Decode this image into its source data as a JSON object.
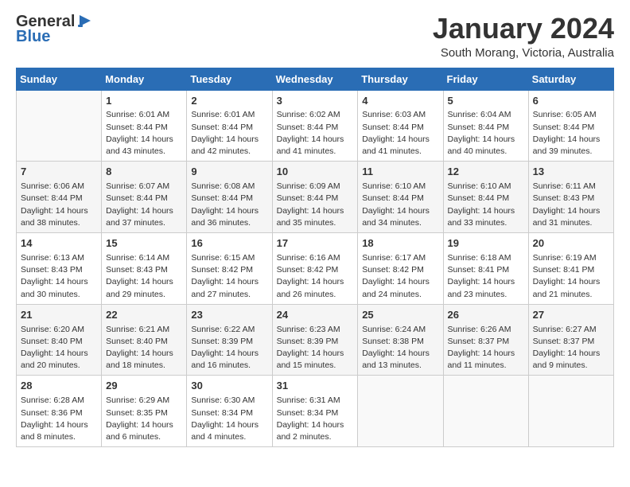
{
  "header": {
    "logo_line1": "General",
    "logo_line2": "Blue",
    "month": "January 2024",
    "location": "South Morang, Victoria, Australia"
  },
  "weekdays": [
    "Sunday",
    "Monday",
    "Tuesday",
    "Wednesday",
    "Thursday",
    "Friday",
    "Saturday"
  ],
  "weeks": [
    [
      {
        "day": "",
        "sunrise": "",
        "sunset": "",
        "daylight": ""
      },
      {
        "day": "1",
        "sunrise": "Sunrise: 6:01 AM",
        "sunset": "Sunset: 8:44 PM",
        "daylight": "Daylight: 14 hours and 43 minutes."
      },
      {
        "day": "2",
        "sunrise": "Sunrise: 6:01 AM",
        "sunset": "Sunset: 8:44 PM",
        "daylight": "Daylight: 14 hours and 42 minutes."
      },
      {
        "day": "3",
        "sunrise": "Sunrise: 6:02 AM",
        "sunset": "Sunset: 8:44 PM",
        "daylight": "Daylight: 14 hours and 41 minutes."
      },
      {
        "day": "4",
        "sunrise": "Sunrise: 6:03 AM",
        "sunset": "Sunset: 8:44 PM",
        "daylight": "Daylight: 14 hours and 41 minutes."
      },
      {
        "day": "5",
        "sunrise": "Sunrise: 6:04 AM",
        "sunset": "Sunset: 8:44 PM",
        "daylight": "Daylight: 14 hours and 40 minutes."
      },
      {
        "day": "6",
        "sunrise": "Sunrise: 6:05 AM",
        "sunset": "Sunset: 8:44 PM",
        "daylight": "Daylight: 14 hours and 39 minutes."
      }
    ],
    [
      {
        "day": "7",
        "sunrise": "Sunrise: 6:06 AM",
        "sunset": "Sunset: 8:44 PM",
        "daylight": "Daylight: 14 hours and 38 minutes."
      },
      {
        "day": "8",
        "sunrise": "Sunrise: 6:07 AM",
        "sunset": "Sunset: 8:44 PM",
        "daylight": "Daylight: 14 hours and 37 minutes."
      },
      {
        "day": "9",
        "sunrise": "Sunrise: 6:08 AM",
        "sunset": "Sunset: 8:44 PM",
        "daylight": "Daylight: 14 hours and 36 minutes."
      },
      {
        "day": "10",
        "sunrise": "Sunrise: 6:09 AM",
        "sunset": "Sunset: 8:44 PM",
        "daylight": "Daylight: 14 hours and 35 minutes."
      },
      {
        "day": "11",
        "sunrise": "Sunrise: 6:10 AM",
        "sunset": "Sunset: 8:44 PM",
        "daylight": "Daylight: 14 hours and 34 minutes."
      },
      {
        "day": "12",
        "sunrise": "Sunrise: 6:10 AM",
        "sunset": "Sunset: 8:44 PM",
        "daylight": "Daylight: 14 hours and 33 minutes."
      },
      {
        "day": "13",
        "sunrise": "Sunrise: 6:11 AM",
        "sunset": "Sunset: 8:43 PM",
        "daylight": "Daylight: 14 hours and 31 minutes."
      }
    ],
    [
      {
        "day": "14",
        "sunrise": "Sunrise: 6:13 AM",
        "sunset": "Sunset: 8:43 PM",
        "daylight": "Daylight: 14 hours and 30 minutes."
      },
      {
        "day": "15",
        "sunrise": "Sunrise: 6:14 AM",
        "sunset": "Sunset: 8:43 PM",
        "daylight": "Daylight: 14 hours and 29 minutes."
      },
      {
        "day": "16",
        "sunrise": "Sunrise: 6:15 AM",
        "sunset": "Sunset: 8:42 PM",
        "daylight": "Daylight: 14 hours and 27 minutes."
      },
      {
        "day": "17",
        "sunrise": "Sunrise: 6:16 AM",
        "sunset": "Sunset: 8:42 PM",
        "daylight": "Daylight: 14 hours and 26 minutes."
      },
      {
        "day": "18",
        "sunrise": "Sunrise: 6:17 AM",
        "sunset": "Sunset: 8:42 PM",
        "daylight": "Daylight: 14 hours and 24 minutes."
      },
      {
        "day": "19",
        "sunrise": "Sunrise: 6:18 AM",
        "sunset": "Sunset: 8:41 PM",
        "daylight": "Daylight: 14 hours and 23 minutes."
      },
      {
        "day": "20",
        "sunrise": "Sunrise: 6:19 AM",
        "sunset": "Sunset: 8:41 PM",
        "daylight": "Daylight: 14 hours and 21 minutes."
      }
    ],
    [
      {
        "day": "21",
        "sunrise": "Sunrise: 6:20 AM",
        "sunset": "Sunset: 8:40 PM",
        "daylight": "Daylight: 14 hours and 20 minutes."
      },
      {
        "day": "22",
        "sunrise": "Sunrise: 6:21 AM",
        "sunset": "Sunset: 8:40 PM",
        "daylight": "Daylight: 14 hours and 18 minutes."
      },
      {
        "day": "23",
        "sunrise": "Sunrise: 6:22 AM",
        "sunset": "Sunset: 8:39 PM",
        "daylight": "Daylight: 14 hours and 16 minutes."
      },
      {
        "day": "24",
        "sunrise": "Sunrise: 6:23 AM",
        "sunset": "Sunset: 8:39 PM",
        "daylight": "Daylight: 14 hours and 15 minutes."
      },
      {
        "day": "25",
        "sunrise": "Sunrise: 6:24 AM",
        "sunset": "Sunset: 8:38 PM",
        "daylight": "Daylight: 14 hours and 13 minutes."
      },
      {
        "day": "26",
        "sunrise": "Sunrise: 6:26 AM",
        "sunset": "Sunset: 8:37 PM",
        "daylight": "Daylight: 14 hours and 11 minutes."
      },
      {
        "day": "27",
        "sunrise": "Sunrise: 6:27 AM",
        "sunset": "Sunset: 8:37 PM",
        "daylight": "Daylight: 14 hours and 9 minutes."
      }
    ],
    [
      {
        "day": "28",
        "sunrise": "Sunrise: 6:28 AM",
        "sunset": "Sunset: 8:36 PM",
        "daylight": "Daylight: 14 hours and 8 minutes."
      },
      {
        "day": "29",
        "sunrise": "Sunrise: 6:29 AM",
        "sunset": "Sunset: 8:35 PM",
        "daylight": "Daylight: 14 hours and 6 minutes."
      },
      {
        "day": "30",
        "sunrise": "Sunrise: 6:30 AM",
        "sunset": "Sunset: 8:34 PM",
        "daylight": "Daylight: 14 hours and 4 minutes."
      },
      {
        "day": "31",
        "sunrise": "Sunrise: 6:31 AM",
        "sunset": "Sunset: 8:34 PM",
        "daylight": "Daylight: 14 hours and 2 minutes."
      },
      {
        "day": "",
        "sunrise": "",
        "sunset": "",
        "daylight": ""
      },
      {
        "day": "",
        "sunrise": "",
        "sunset": "",
        "daylight": ""
      },
      {
        "day": "",
        "sunrise": "",
        "sunset": "",
        "daylight": ""
      }
    ]
  ]
}
